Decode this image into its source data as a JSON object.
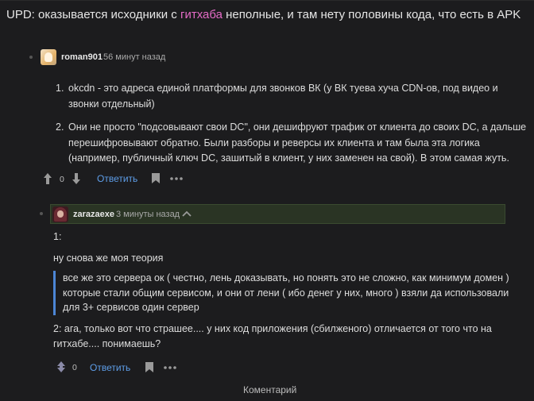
{
  "headline": {
    "before": "UPD: оказывается исходники с ",
    "link": "гитхаба",
    "after": " неполные, и там нету половины кода, что есть в APK"
  },
  "comment1": {
    "username": "roman901",
    "time": "56 минут назад",
    "items": [
      {
        "num": "1.",
        "lines": [
          "okcdn - это адреса единой платформы для звонков ВК (у ВК туева хуча CDN-ов, под видео и",
          "звонки отдельный)"
        ]
      },
      {
        "num": "2.",
        "lines": [
          "Они не просто \"подсовывают свои DC\", они дешифруют трафик от клиента до своих DC, а дальше",
          "перешифровывают обратно. Были разборы и реверсы их клиента и там была эта логика",
          "(например, публичный ключ DC, зашитый в клиент, у них заменен на свой). В этом самая жуть."
        ]
      }
    ],
    "vote_count": "0",
    "reply_label": "Ответить"
  },
  "comment2": {
    "username": "zarazaexe",
    "time": "3 минуты назад",
    "line1": "1:",
    "line2": "ну снова же моя теория",
    "quote_lines": [
      "все же это сервера ок ( честно, лень доказывать, но понять это не сложно, как минимум домен )",
      "которые стали общим сервисом, и они от лени ( ибо денег у них, много ) взяли да использовали",
      "для 3+ сервисов один сервер"
    ],
    "line3a": "2: ага, только вот что страшее.... у них код приложения (сбилженого) отличается от того что на",
    "line3b": "гитхабе.... понимаешь?",
    "vote_count": "0",
    "reply_label": "Ответить"
  },
  "footer": {
    "comment_label": "Коментарий"
  },
  "colors": {
    "background": "#1c1c1e",
    "link_pink": "#e46bc6",
    "reply_blue": "#5e9ee9",
    "highlight_bg": "#2a3424",
    "quote_border": "#4c86d6"
  },
  "icons": [
    "arrow-up-icon",
    "arrow-down-icon",
    "bookmark-icon",
    "more-icon",
    "chevron-up-icon",
    "vote-diamond-icon"
  ]
}
